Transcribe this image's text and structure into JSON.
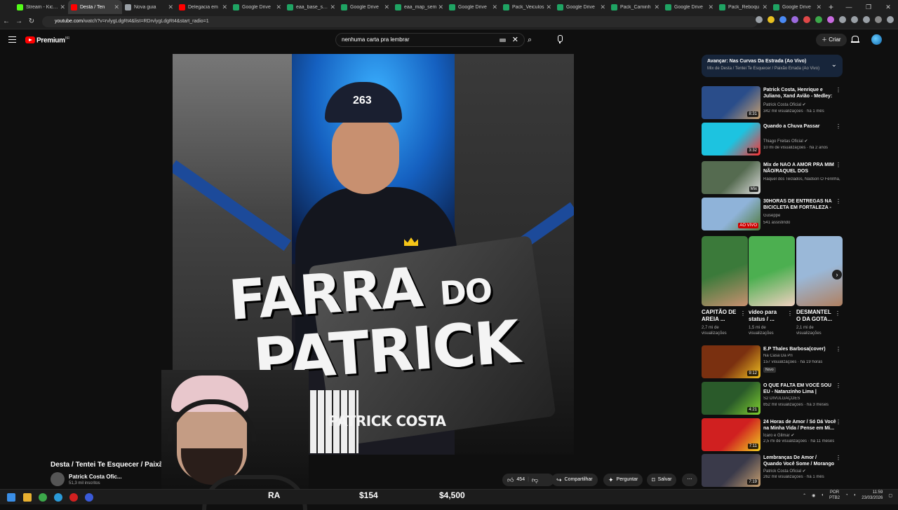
{
  "browser": {
    "tabs": [
      {
        "label": "Stream - Kick D",
        "color": "#53fc18"
      },
      {
        "label": "Desta / Ten",
        "color": "#ff0000",
        "active": true
      },
      {
        "label": "Nova guia",
        "color": "#9aa0a6"
      },
      {
        "label": "Delegacia em",
        "color": "#ff0000"
      },
      {
        "label": "Google Drive",
        "color": "#1fa463"
      },
      {
        "label": "eaa_base_shar",
        "color": "#1fa463"
      },
      {
        "label": "Google Drive",
        "color": "#1fa463"
      },
      {
        "label": "eaa_map_sem",
        "color": "#1fa463"
      },
      {
        "label": "Google Drive",
        "color": "#1fa463"
      },
      {
        "label": "Pack_Veiculos",
        "color": "#1fa463"
      },
      {
        "label": "Google Drive",
        "color": "#1fa463"
      },
      {
        "label": "Pack_Caminh",
        "color": "#1fa463"
      },
      {
        "label": "Google Drive",
        "color": "#1fa463"
      },
      {
        "label": "Pack_Reboqu",
        "color": "#1fa463"
      },
      {
        "label": "Google Drive",
        "color": "#1fa463"
      }
    ],
    "url_host": "youtube.com",
    "url_path": "/watch?v=rvlygLdgRt4&list=RDrvlygLdgRt4&start_radio=1"
  },
  "youtube": {
    "logo_text": "Premium",
    "logo_sup": "BR",
    "search_value": "nenhuma carta pra lembrar",
    "create_label": "Criar"
  },
  "video": {
    "title": "Desta / Tentei Te Esquecer / Paixão E...",
    "cap_number": "263",
    "art_title_1": "FARRA",
    "art_title_do": "DO",
    "art_title_2": "PATRICK",
    "art_artist": "PATRICK COSTA",
    "channel": "Patrick Costa Ofic...",
    "subscribers": "51,3 mil inscritos",
    "likes": "454",
    "share_label": "Compartilhar",
    "ask_label": "Perguntar",
    "save_label": "Salvar"
  },
  "autoplay": {
    "title": "Avançar: Nas Curvas Da Estrada (Ao Vivo)",
    "subtitle": "Mix de Desta / Tentei Te Esquecer / Paixão Errada (Ao Vivo)"
  },
  "recs_top": [
    {
      "title": "Patrick Costa, Henrique e Juliano, Xand Avião - Medley: ...",
      "channel": "Patrick Costa Oficial ✔",
      "meta": "342 mil visualizações · há 1 mês",
      "dur": "8:31",
      "c1": "#2a4d8a",
      "c2": "#c8a070"
    },
    {
      "title": "Quando a Chuva Passar",
      "channel": "Thiago Freitas Oficial ✔",
      "meta": "10 mi de visualizações · há 2 anos",
      "dur": "3:32",
      "c1": "#1dc3e0",
      "c2": "#ff3030"
    },
    {
      "title": "Mix de NAO A AMOR PRA MIM NÃO/RAQUEL DOS TECLADOS",
      "channel": "Raquel dos Teclados, Nadson O Ferinha, ...",
      "meta": "",
      "dur": "Mix",
      "c1": "#556b50",
      "c2": "#ddd"
    },
    {
      "title": "30HORAS DE ENTREGAS NA BICICLETA EM FORTALEZA - S...",
      "channel": "Guseppe",
      "meta": "541 assistindo",
      "dur": "AO VIVO",
      "live": true,
      "c1": "#8fb3d9",
      "c2": "#507a3a"
    }
  ],
  "shorts": [
    {
      "title": "CAPITÃO DE AREIA ...",
      "meta": "2,7 mi de visualizações",
      "c1": "#3b7a3a",
      "c2": "#c89070"
    },
    {
      "title": "vídeo para status / ...",
      "meta": "1,5 mi de visualizações",
      "c1": "#4caf50",
      "c2": "#f0d0c0"
    },
    {
      "title": "DESMANTEL O DA GOTA...",
      "meta": "2,1 mi de visualizações",
      "c1": "#9ab8d8",
      "c2": "#b08060"
    }
  ],
  "recs_bottom": [
    {
      "title": "E.P Thales Barbosa(cover)",
      "channel": "Na Casa Da Pri",
      "meta": "157 visualizações · há 19 horas",
      "badge": "Novo",
      "dur": "9:12",
      "c1": "#7a3010",
      "c2": "#f0c020"
    },
    {
      "title": "O QUE FALTA EM VOCÊ SOU EU - Natanzinho Lima | Dezembro ...",
      "channel": "S2 DIVULGAÇÕES",
      "meta": "852 mil visualizações · há 3 meses",
      "dur": "4:21",
      "c1": "#2a5a2a",
      "c2": "#7fd030"
    },
    {
      "title": "24 Horas de Amor / Só Dá Você na Minha Vida / Pense em Mi...",
      "channel": "Ícaro e Gilmar ✔",
      "meta": "2,5 mi de visualizações · há 11 meses",
      "dur": "7:11",
      "c1": "#d02020",
      "c2": "#f0d020"
    },
    {
      "title": "Lembranças De Amor / Quando Você Some / Morango Do ...",
      "channel": "Patrick Costa Oficial ✔",
      "meta": "262 mil visualizações · há 1 mês",
      "dur": "7:19",
      "c1": "#3a3a4a",
      "c2": "#c8a070"
    }
  ],
  "taskbar": {
    "ticker": [
      "RA",
      "$154",
      "$4,500"
    ],
    "lang_1": "POR",
    "lang_2": "PTB2",
    "time": "11:59",
    "date": "23/03/2026"
  }
}
